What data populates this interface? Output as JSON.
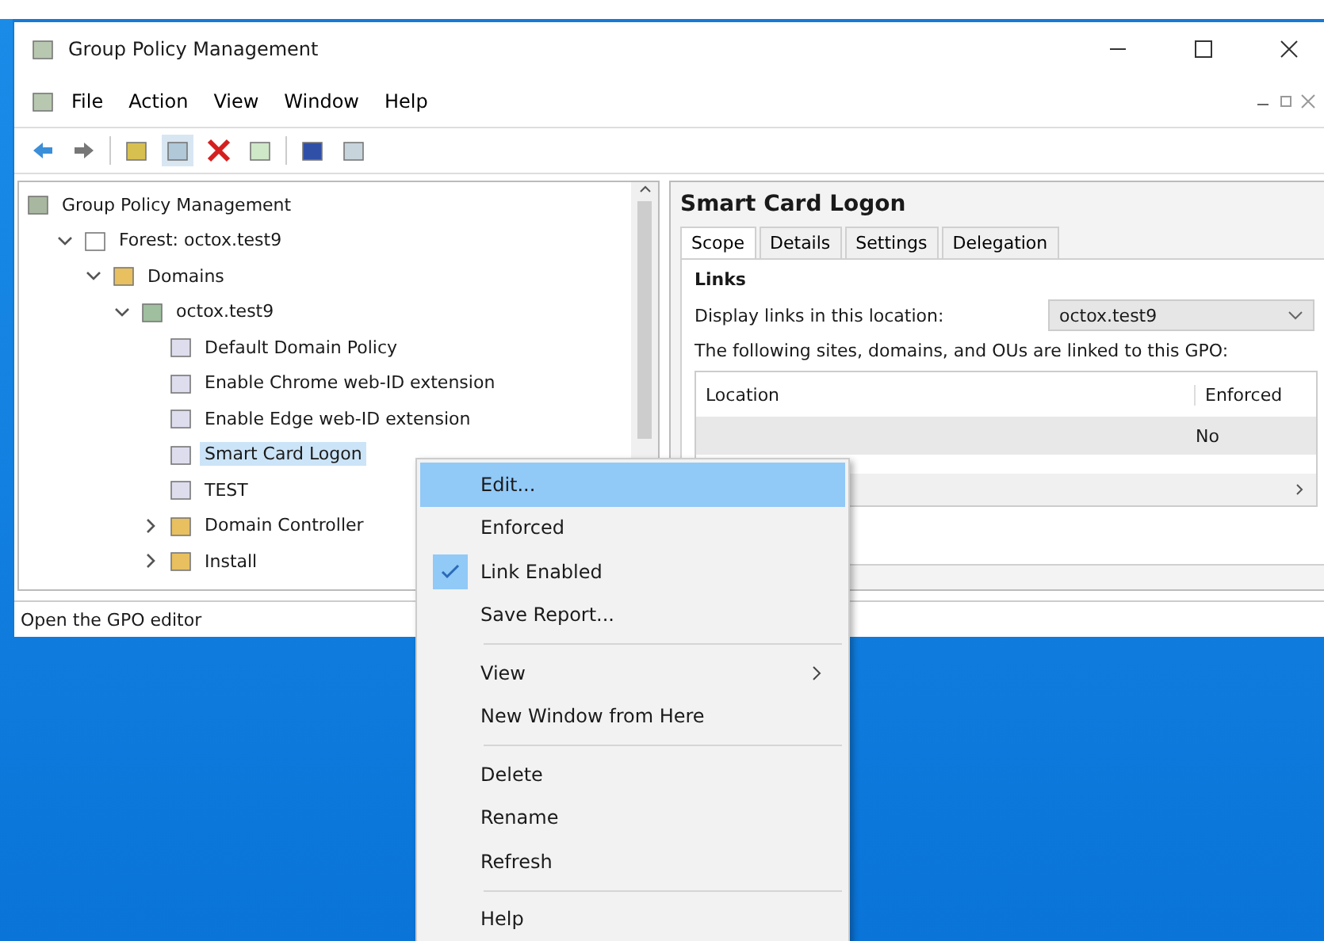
{
  "window": {
    "title": "Group Policy Management"
  },
  "menu_bar": [
    "File",
    "Action",
    "View",
    "Window",
    "Help"
  ],
  "tree": [
    {
      "label": "Group Policy Management",
      "kind": "root",
      "selected": false,
      "children": [
        {
          "label": "Forest: octox.test9",
          "kind": "forest",
          "expanded": true,
          "selected": false,
          "children": [
            {
              "label": "Domains",
              "kind": "domains",
              "expanded": true,
              "selected": false,
              "children": [
                {
                  "label": "octox.test9",
                  "kind": "domain",
                  "expanded": true,
                  "selected": false,
                  "children": [
                    {
                      "label": "Default Domain Policy",
                      "kind": "gpo",
                      "selected": false
                    },
                    {
                      "label": "Enable Chrome web-ID extension",
                      "kind": "gpo",
                      "selected": false
                    },
                    {
                      "label": "Enable Edge web-ID extension",
                      "kind": "gpo",
                      "selected": false
                    },
                    {
                      "label": "Smart Card Logon",
                      "kind": "gpo",
                      "selected": true
                    },
                    {
                      "label": "TEST",
                      "kind": "gpo",
                      "selected": false
                    },
                    {
                      "label": "Domain Controller",
                      "kind": "ou",
                      "expanded": false,
                      "selected": false
                    },
                    {
                      "label": "Install",
                      "kind": "ou",
                      "expanded": false,
                      "selected": false
                    }
                  ]
                }
              ]
            }
          ]
        }
      ]
    }
  ],
  "status_bar": "Open the GPO editor",
  "details": {
    "title": "Smart Card Logon",
    "tabs": [
      {
        "label": "Scope",
        "selected": true
      },
      {
        "label": "Details",
        "selected": false
      },
      {
        "label": "Settings",
        "selected": false
      },
      {
        "label": "Delegation",
        "selected": false
      }
    ],
    "section": "Links",
    "location_label": "Display links in this location:",
    "location_value": "octox.test9",
    "linked_text": "The following sites, domains, and OUs are linked to this GPO:",
    "table": {
      "columns": [
        "Location",
        "Enforced"
      ],
      "rows": [
        {
          "enforced": "No",
          "selected": true
        }
      ]
    }
  },
  "context_menu": [
    {
      "kind": "item",
      "label": "Edit...",
      "selected": true,
      "checked": false
    },
    {
      "kind": "item",
      "label": "Enforced",
      "selected": false,
      "checked": false
    },
    {
      "kind": "item",
      "label": "Link Enabled",
      "selected": false,
      "checked": true
    },
    {
      "kind": "item",
      "label": "Save Report...",
      "selected": false,
      "checked": false
    },
    {
      "kind": "separator"
    },
    {
      "kind": "submenu",
      "label": "View",
      "selected": false,
      "checked": false
    },
    {
      "kind": "item",
      "label": "New Window from Here",
      "selected": false,
      "checked": false
    },
    {
      "kind": "separator"
    },
    {
      "kind": "item",
      "label": "Delete",
      "selected": false,
      "checked": false
    },
    {
      "kind": "item",
      "label": "Rename",
      "selected": false,
      "checked": false
    },
    {
      "kind": "item",
      "label": "Refresh",
      "selected": false,
      "checked": false
    },
    {
      "kind": "separator"
    },
    {
      "kind": "item",
      "label": "Help",
      "selected": false,
      "checked": false
    }
  ]
}
